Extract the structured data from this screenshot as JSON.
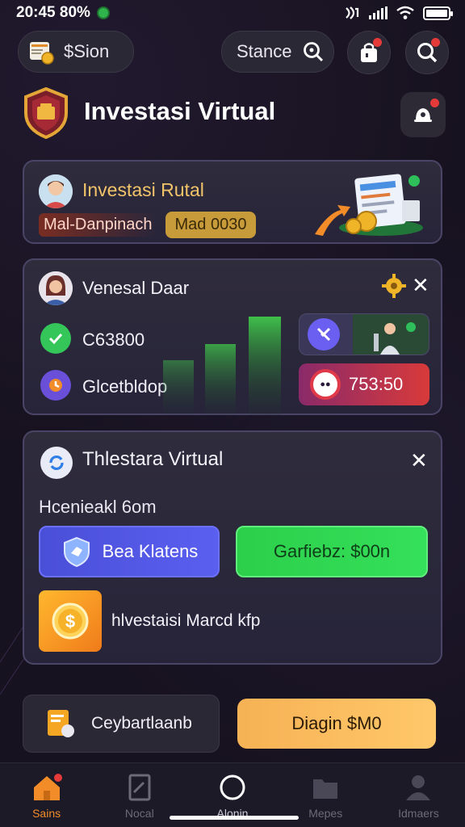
{
  "status_bar": {
    "time": "20:45 80%",
    "icons": [
      "status-app-icon",
      "nfc-icon",
      "signal-icon",
      "wifi-icon",
      "battery-icon"
    ]
  },
  "top_bar": {
    "balance_label": "$Sion",
    "search_label": "Stance",
    "icons": [
      "wallet-icon",
      "search-icon",
      "bag-icon",
      "search-icon"
    ]
  },
  "header": {
    "title": "Investasi Virtual",
    "icons": [
      "shield-emblem-icon",
      "bell-icon"
    ]
  },
  "card_promo": {
    "title": "Investasi Rutal",
    "tag_primary": "Mal-Danpinach",
    "tag_secondary": "Mad 0030",
    "icons": [
      "avatar-icon",
      "document-coins-icon",
      "arrow-up-icon"
    ]
  },
  "card_portfolio": {
    "title": "Venesal Daar",
    "row1_value": "C63800",
    "row2_label": "Glcetbldop",
    "right_value": "753:50",
    "icons": [
      "avatar-icon",
      "gear-icon",
      "close-icon",
      "check-icon",
      "clock-icon",
      "x-logo-icon",
      "person-icon",
      "record-icon"
    ]
  },
  "card_actions": {
    "title": "Thlestara Virtual",
    "subtitle": "Hcenieakl 6om",
    "btn_primary": "Bea Klatens",
    "btn_secondary": "Garfiebz: $00n",
    "coin_label": "hlvestaisi Marcd kfp",
    "icons": [
      "sync-icon",
      "close-icon",
      "shield-icon",
      "dollar-coin-icon"
    ]
  },
  "bottom_actions": {
    "left_label": "Ceybartlaanb",
    "right_label": "Diagin $M0",
    "icons": [
      "document-icon"
    ]
  },
  "bottom_nav": [
    {
      "label": "Sains",
      "icon": "home-icon",
      "active": true
    },
    {
      "label": "Nocal",
      "icon": "document-icon",
      "active": false
    },
    {
      "label": "Alonin",
      "icon": "circle-icon",
      "active": false
    },
    {
      "label": "Mepes",
      "icon": "folder-icon",
      "active": false
    },
    {
      "label": "Idmaers",
      "icon": "profile-icon",
      "active": false
    }
  ],
  "colors": {
    "background": "#17121f",
    "card": "#2f2c3c",
    "accent_gold": "#f2c46a",
    "accent_green": "#35e05a",
    "accent_blue": "#5a5ff0",
    "accent_orange": "#f28c28",
    "notification_red": "#e53a3a"
  }
}
